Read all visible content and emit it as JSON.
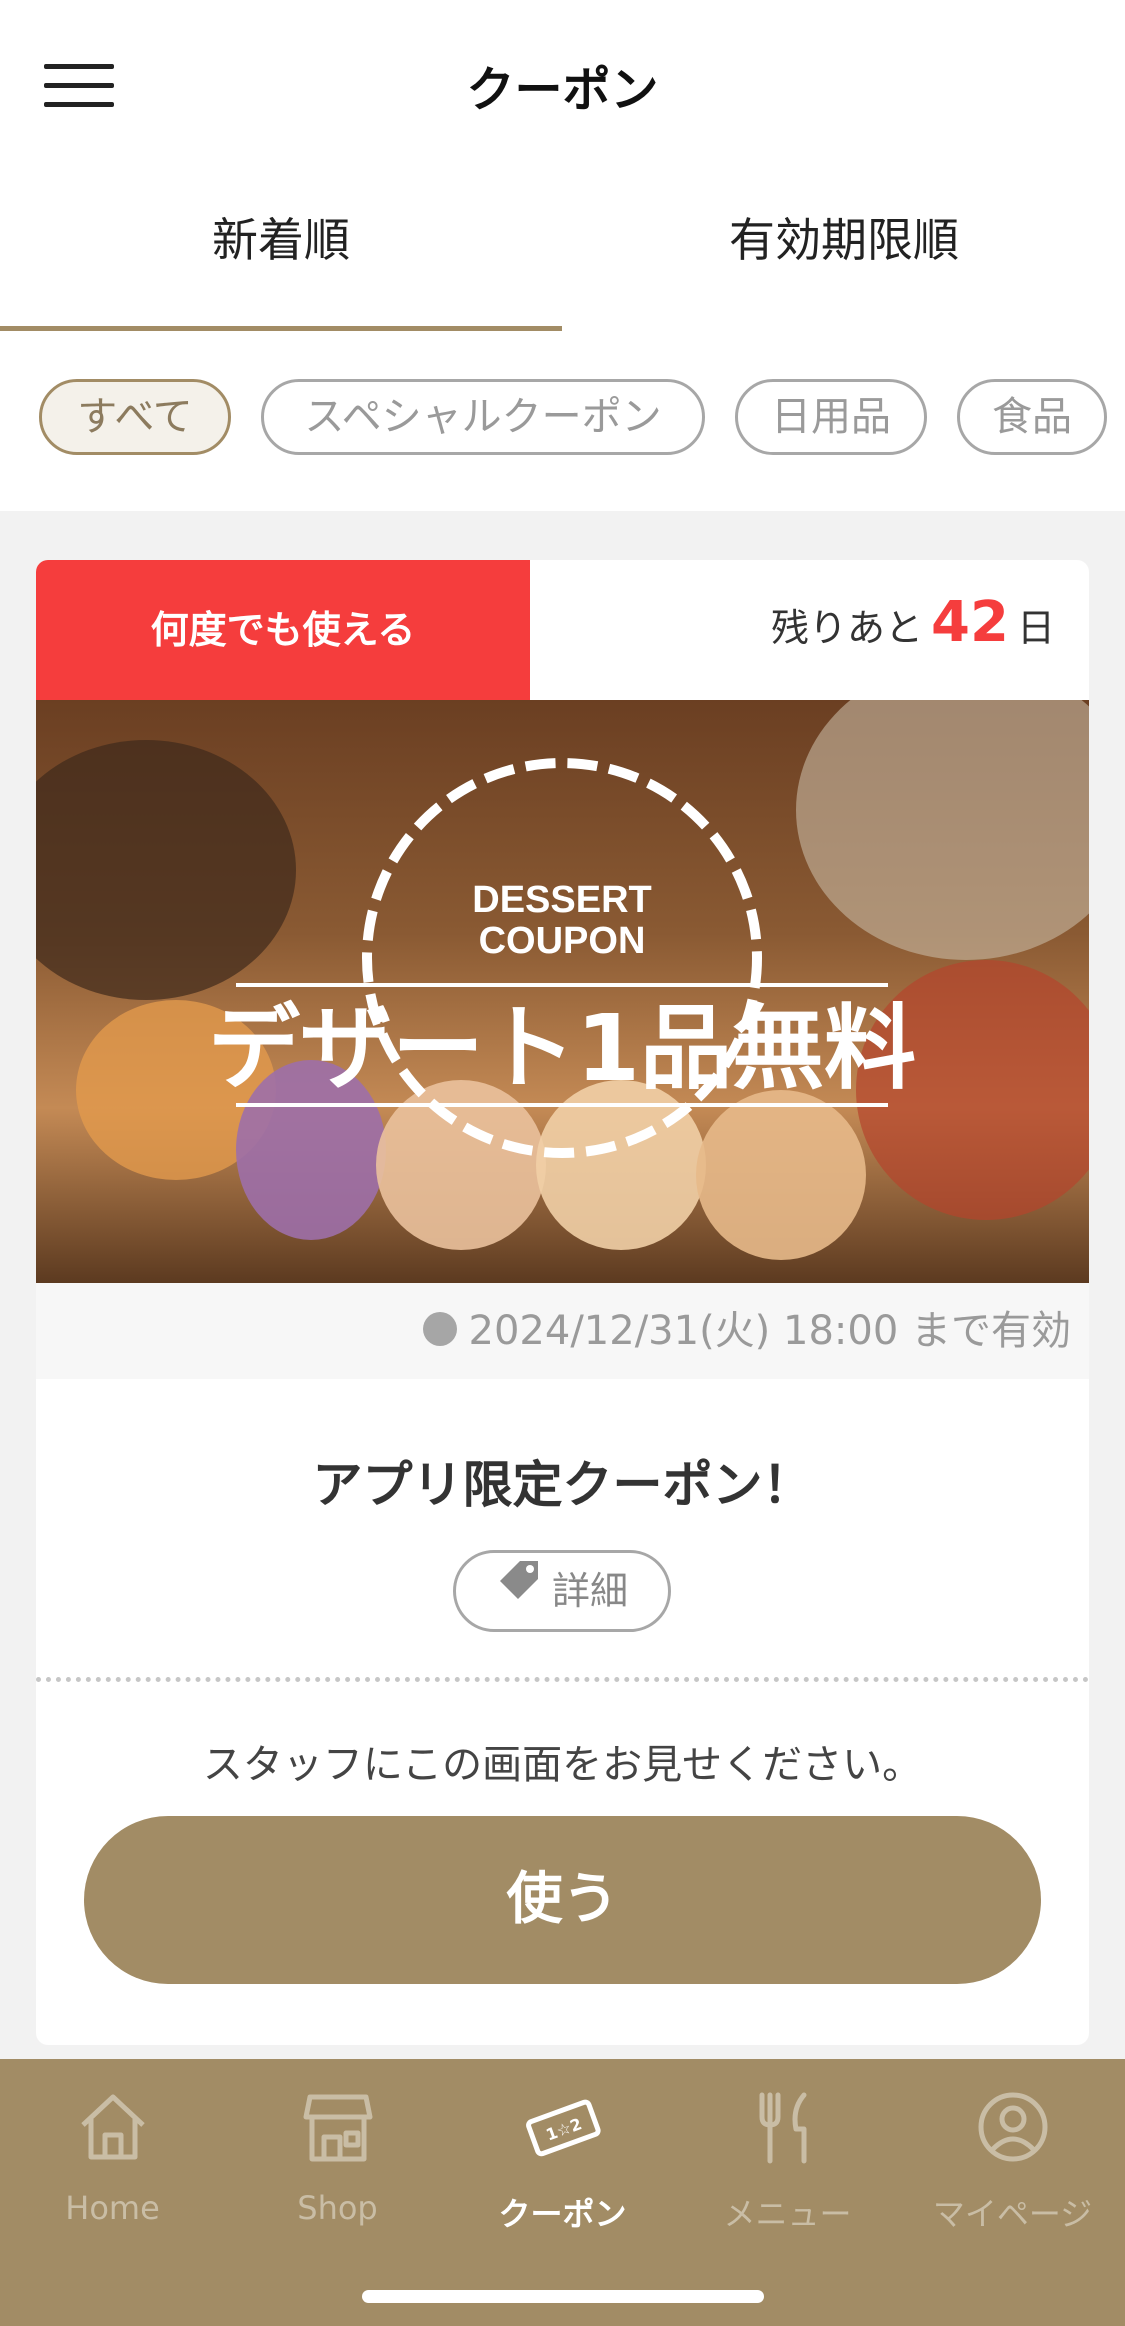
{
  "header": {
    "title": "クーポン",
    "menu_icon": "hamburger-icon"
  },
  "sort_tabs": [
    {
      "label": "新着順",
      "active": true
    },
    {
      "label": "有効期限順",
      "active": false
    }
  ],
  "filter_chips": [
    {
      "label": "すべて",
      "active": true
    },
    {
      "label": "スペシャルクーポン",
      "active": false
    },
    {
      "label": "日用品",
      "active": false
    },
    {
      "label": "食品",
      "active": false
    }
  ],
  "coupon": {
    "badge": "何度でも使える",
    "remain_prefix": "残りあと",
    "remain_days": "42",
    "remain_suffix": "日",
    "image": {
      "badge_line1": "DESSERT",
      "badge_line2": "COUPON",
      "headline": "デザート1品無料"
    },
    "expiry": "2024/12/31(火) 18:00 まで有効",
    "title": "アプリ限定クーポン！",
    "detail_label": "詳細",
    "instruction": "スタッフにこの画面をお見せください。",
    "use_label": "使う"
  },
  "tab_bar": [
    {
      "label": "Home",
      "icon": "home-icon",
      "active": false
    },
    {
      "label": "Shop",
      "icon": "shop-icon",
      "active": false
    },
    {
      "label": "クーポン",
      "icon": "ticket-icon",
      "active": true
    },
    {
      "label": "メニュー",
      "icon": "cutlery-icon",
      "active": false
    },
    {
      "label": "マイページ",
      "icon": "user-icon",
      "active": false
    }
  ],
  "colors": {
    "accent": "#a28c65",
    "badge_red": "#f53d3d",
    "background": "#f2f2f2"
  }
}
